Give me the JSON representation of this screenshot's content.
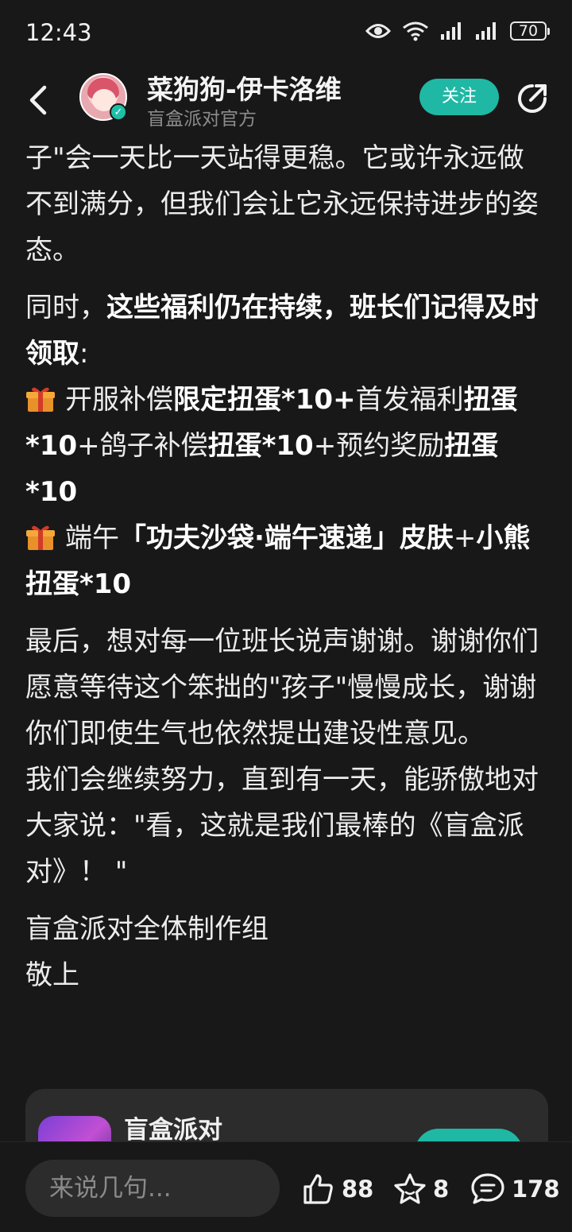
{
  "status": {
    "time": "12:43",
    "battery": "70"
  },
  "header": {
    "author_name": "菜狗狗-伊卡洛维",
    "author_sub": "盲盒派对官方",
    "follow_label": "关注"
  },
  "content": {
    "p1": "子\"会一天比一天站得更稳。它或许永远做不到满分，但我们会让它永远保持进步的姿态。",
    "p2_a": "同时，",
    "p2_b": "这些福利仍在持续，班长们记得及时领取",
    "p2_c": ":",
    "p3_a": "开服补偿",
    "p3_b": "限定扭蛋*10+",
    "p3_c": "首发福利",
    "p3_d": "扭蛋*10",
    "p3_e": "+鸽子补偿",
    "p3_f": "扭蛋*10",
    "p3_g": "+预约奖励",
    "p3_h": "扭蛋*10",
    "p4_a": "端午",
    "p4_b": "「功夫沙袋·端午速递」皮肤",
    "p4_c": "+",
    "p4_d": "小熊扭蛋*10",
    "p5": "最后，想对每一位班长说声谢谢。谢谢你们愿意等待这个笨拙的\"孩子\"慢慢成长，谢谢你们即使生气也依然提出建设性意见。",
    "p6": "我们会继续努力，直到有一天，能骄傲地对大家说：\"看，这就是我们最棒的《盲盒派对》！ \"",
    "p7": "盲盒派对全体制作组",
    "p8": "敬上"
  },
  "card": {
    "title": "盲盒派对"
  },
  "bottom": {
    "comment_placeholder": "来说几句...",
    "likes": "88",
    "favorites": "8",
    "comments": "178"
  },
  "colors": {
    "accent": "#1fb8a4",
    "background": "#181818"
  }
}
